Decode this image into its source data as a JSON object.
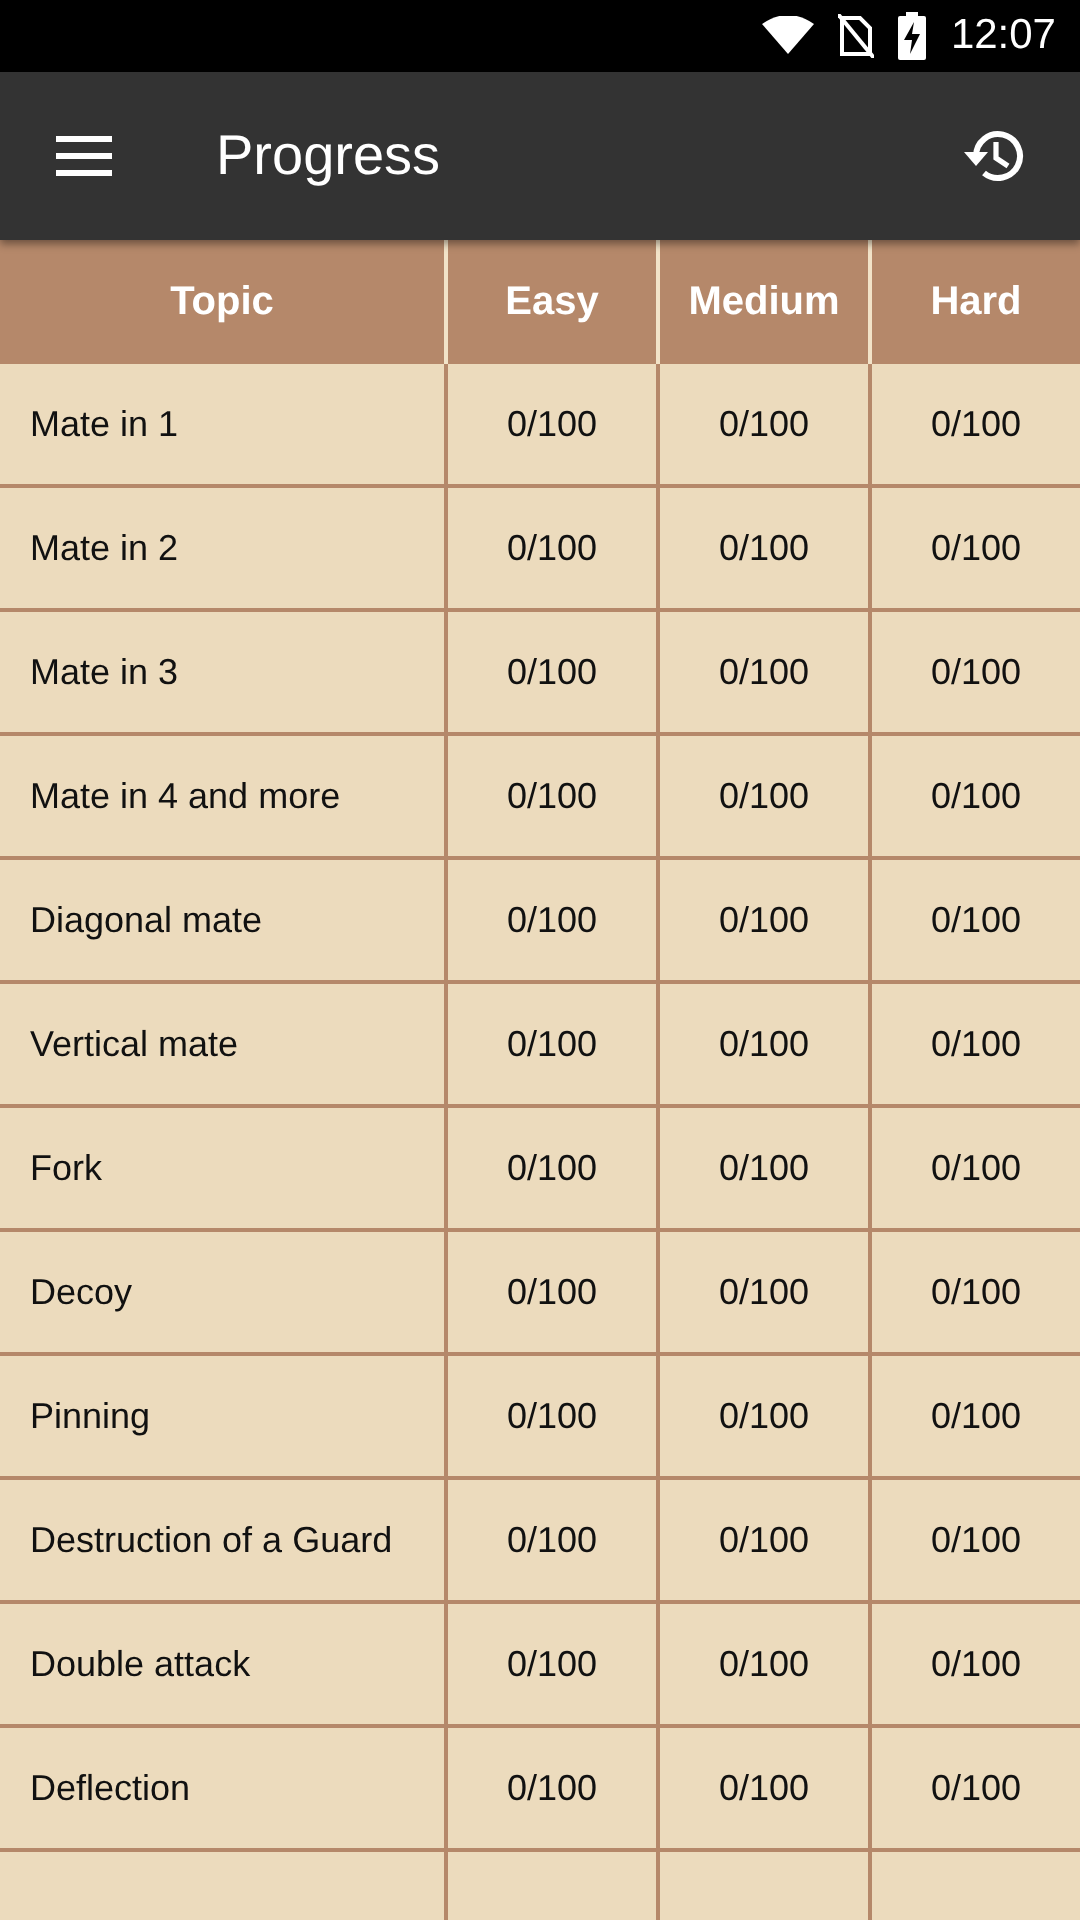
{
  "status_bar": {
    "time": "12:07"
  },
  "app_bar": {
    "title": "Progress"
  },
  "table": {
    "columns": [
      "Topic",
      "Easy",
      "Medium",
      "Hard"
    ],
    "rows": [
      [
        "Mate in 1",
        "0/100",
        "0/100",
        "0/100"
      ],
      [
        "Mate in 2",
        "0/100",
        "0/100",
        "0/100"
      ],
      [
        "Mate in 3",
        "0/100",
        "0/100",
        "0/100"
      ],
      [
        "Mate in 4 and more",
        "0/100",
        "0/100",
        "0/100"
      ],
      [
        "Diagonal mate",
        "0/100",
        "0/100",
        "0/100"
      ],
      [
        "Vertical mate",
        "0/100",
        "0/100",
        "0/100"
      ],
      [
        "Fork",
        "0/100",
        "0/100",
        "0/100"
      ],
      [
        "Decoy",
        "0/100",
        "0/100",
        "0/100"
      ],
      [
        "Pinning",
        "0/100",
        "0/100",
        "0/100"
      ],
      [
        "Destruction of a Guard",
        "0/100",
        "0/100",
        "0/100"
      ],
      [
        "Double attack",
        "0/100",
        "0/100",
        "0/100"
      ],
      [
        "Deflection",
        "0/100",
        "0/100",
        "0/100"
      ]
    ]
  }
}
